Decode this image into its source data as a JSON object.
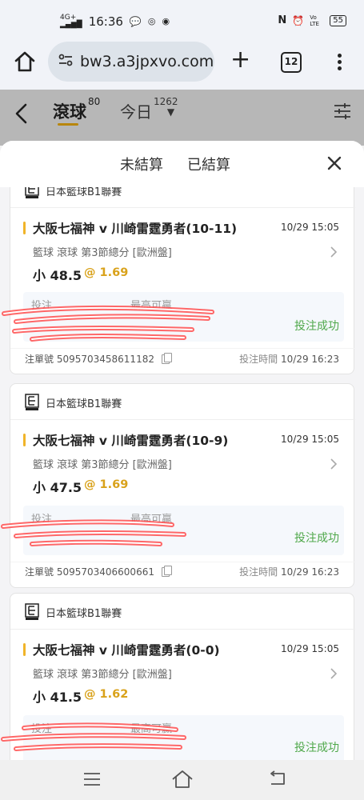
{
  "status_bar": {
    "network": "4G+",
    "time": "16:36",
    "battery": "55",
    "left_icons": [
      "chat-bubble-icon",
      "instagram-icon",
      "app-icon"
    ],
    "right_icons": [
      "nfc-icon",
      "alarm-icon",
      "volte-icon"
    ],
    "volte_label": "Vo LTE"
  },
  "browser": {
    "url": "bw3.a3jpxvo.com",
    "tab_count": "12"
  },
  "header": {
    "live_tab": {
      "label": "滾球",
      "count": "80"
    },
    "today_tab": {
      "label": "今日",
      "count": "1262"
    }
  },
  "sheet": {
    "tabs": [
      "未結算",
      "已結算"
    ],
    "active_tab": "未結算"
  },
  "bets": [
    {
      "league": "日本籃球B1聯賽",
      "match": "大阪七福神 v 川崎雷霆勇者(10-11)",
      "match_time": "10/29 15:05",
      "desc": "籃球 滾球   第3節總分 [歐洲盤]",
      "pick": "小 48.5",
      "odds": "@ 1.69",
      "stake_label": "投注",
      "win_label": "最高可贏",
      "status": "投注成功",
      "order_no": "注單號 5095703458611182",
      "bet_time_label": "投注時間",
      "bet_time": "10/29 16:23"
    },
    {
      "league": "日本籃球B1聯賽",
      "match": "大阪七福神 v 川崎雷霆勇者(10-9)",
      "match_time": "10/29 15:05",
      "desc": "籃球 滾球   第3節總分 [歐洲盤]",
      "pick": "小 47.5",
      "odds": "@ 1.69",
      "stake_label": "投注",
      "win_label": "最高可贏",
      "status": "投注成功",
      "order_no": "注單號 5095703406600661",
      "bet_time_label": "投注時間",
      "bet_time": "10/29 16:23"
    },
    {
      "league": "日本籃球B1聯賽",
      "match": "大阪七福神 v 川崎雷霆勇者(0-0)",
      "match_time": "10/29 15:05",
      "desc": "籃球 滾球   第3節總分 [歐洲盤]",
      "pick": "小 41.5",
      "odds": "@ 1.62",
      "stake_label": "投注",
      "win_label": "最高可贏",
      "status": "投注成功"
    }
  ],
  "colors": {
    "accent_gold": "#f0b429",
    "odds_gold": "#d9a21b",
    "success_green": "#4fa84a",
    "redaction_red": "#ff4d4d"
  }
}
